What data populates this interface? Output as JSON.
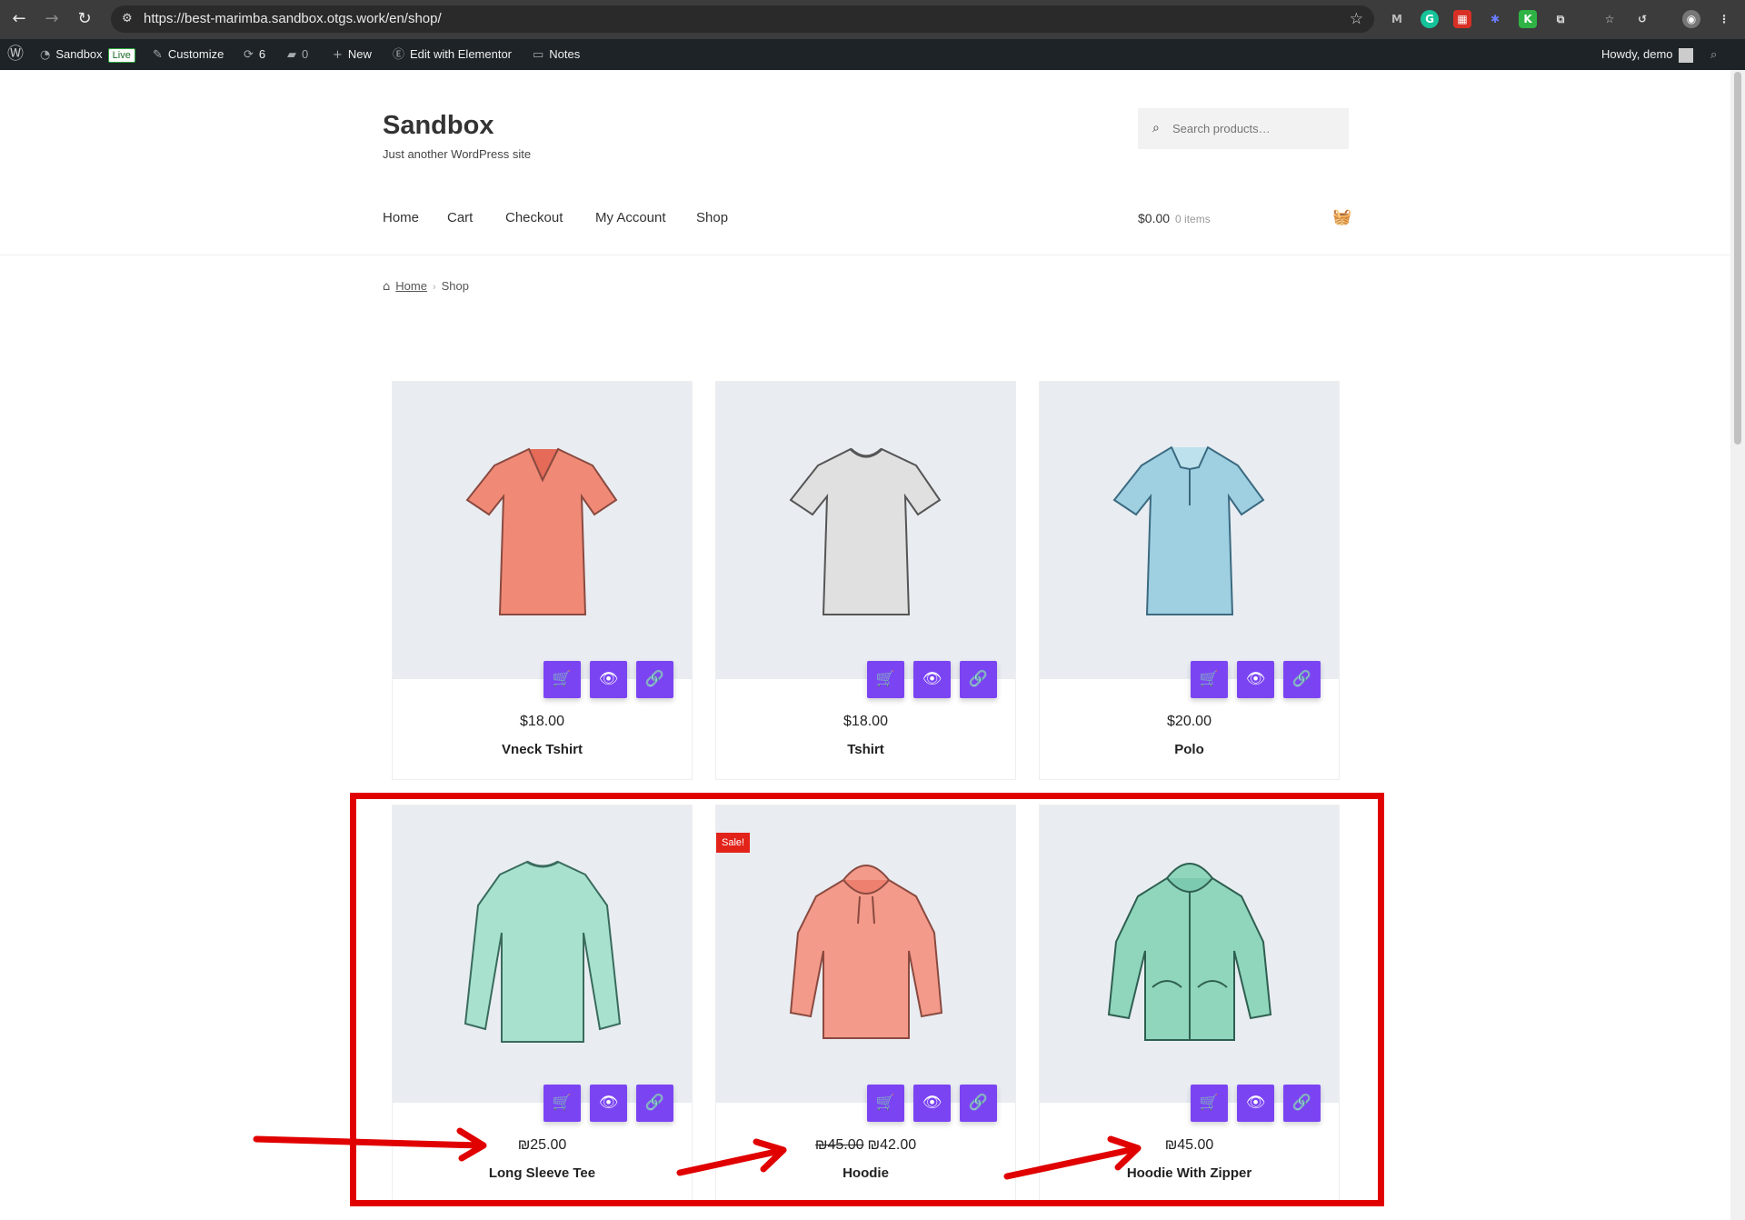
{
  "browser": {
    "url": "https://best-marimba.sandbox.otgs.work/en/shop/"
  },
  "wp_admin_bar": {
    "site_name": "Sandbox",
    "live_badge": "Live",
    "customize": "Customize",
    "updates_count": "6",
    "comments_count": "0",
    "new": "New",
    "edit_with_elementor": "Edit with Elementor",
    "notes": "Notes",
    "howdy": "Howdy, demo"
  },
  "header": {
    "site_title": "Sandbox",
    "tagline": "Just another WordPress site",
    "search_placeholder": "Search products…",
    "menu": [
      "Home",
      "Cart",
      "Checkout",
      "My Account",
      "Shop"
    ],
    "cart_total": "$0.00",
    "cart_items": "0 items"
  },
  "breadcrumb": {
    "home": "Home",
    "current": "Shop"
  },
  "products": [
    {
      "name": "Vneck Tshirt",
      "price": "$18.00",
      "old_price": "",
      "sale": false
    },
    {
      "name": "Tshirt",
      "price": "$18.00",
      "old_price": "",
      "sale": false
    },
    {
      "name": "Polo",
      "price": "$20.00",
      "old_price": "",
      "sale": false
    },
    {
      "name": "Long Sleeve Tee",
      "price": "₪25.00",
      "old_price": "",
      "sale": false
    },
    {
      "name": "Hoodie",
      "price": "₪42.00",
      "old_price": "₪45.00",
      "sale": true
    },
    {
      "name": "Hoodie With Zipper",
      "price": "₪45.00",
      "old_price": "",
      "sale": false
    }
  ],
  "sale_badge": "Sale!",
  "colors": {
    "accent": "#7b44f3",
    "annotation": "#e00000",
    "sale": "#e2231a",
    "admin_bar": "#1d2327"
  }
}
